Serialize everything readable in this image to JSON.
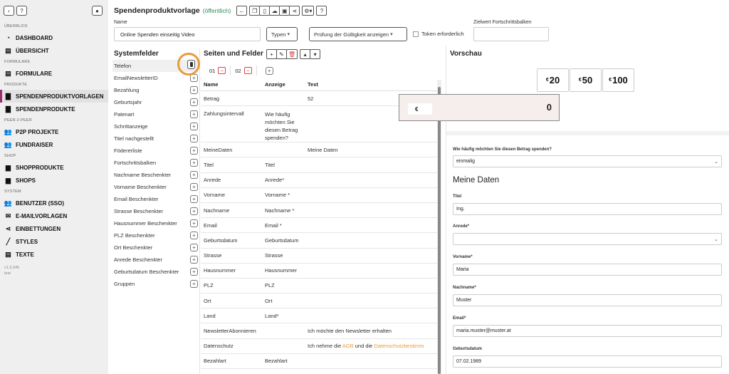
{
  "sidebar": {
    "sections": [
      {
        "title": "ÜBERBLICK",
        "items": [
          {
            "label": "DASHBOARD",
            "icon": "speedometer-icon"
          },
          {
            "label": "ÜBERSICHT",
            "icon": "document-icon"
          }
        ]
      },
      {
        "title": "FORMULARE",
        "items": [
          {
            "label": "FORMULARE",
            "icon": "document-icon"
          }
        ]
      },
      {
        "title": "PRODUKTE",
        "items": [
          {
            "label": "SPENDENPRODUKTVORLAGEN",
            "icon": "folder-icon",
            "active": true
          },
          {
            "label": "SPENDENPRODUKTE",
            "icon": "folder-icon"
          }
        ]
      },
      {
        "title": "PEER-2-PEER",
        "items": [
          {
            "label": "P2P PROJEKTE",
            "icon": "users-icon"
          },
          {
            "label": "FUNDRAISER",
            "icon": "users-icon"
          }
        ]
      },
      {
        "title": "SHOP",
        "items": [
          {
            "label": "SHOPPRODUKTE",
            "icon": "bag-icon"
          },
          {
            "label": "SHOPS",
            "icon": "bag-icon"
          }
        ]
      },
      {
        "title": "SYSTEM",
        "items": [
          {
            "label": "BENUTZER (SSO)",
            "icon": "users-icon"
          },
          {
            "label": "E-MAILVORLAGEN",
            "icon": "envelope-icon"
          },
          {
            "label": "EINBETTUNGEN",
            "icon": "share-icon"
          },
          {
            "label": "STYLES",
            "icon": "pen-icon"
          },
          {
            "label": "TEXTE",
            "icon": "document-icon"
          }
        ]
      }
    ],
    "version": "v1.3.345",
    "env": "test"
  },
  "header": {
    "title": "Spendenproduktvorlage",
    "status": "(öffentlich)"
  },
  "form": {
    "name_label": "Name",
    "name_value": "Online Spenden einseitig Video",
    "type_select": "Typen",
    "validity_select": "Prüfung der Gültigkeit anzeigen",
    "token_label": "Token erforderlich",
    "target_label": "Zielwert Fortschrittsbalken"
  },
  "system_fields": {
    "title": "Systemfelder",
    "items": [
      "Telefon",
      "EmailNewsletterID",
      "Bezahlung",
      "Geburtsjahr",
      "Patenart",
      "Schrittanzeige",
      "Titel nachgestellt",
      "Födererliste",
      "Fortschrittsbalken",
      "Nachname Beschenkter",
      "Vorname Beschenkter",
      "Email Beschenkter",
      "Strasse Beschenkter",
      "Hausnummer Beschenkter",
      "PLZ Beschenkter",
      "Ort Beschenkter",
      "Anrede Beschenkter",
      "Geburtsdatum Beschenkter",
      "Gruppen"
    ]
  },
  "pages": {
    "title": "Seiten und Felder",
    "tabs": [
      "01",
      "02"
    ],
    "columns": [
      "Name",
      "Anzeige",
      "Text"
    ],
    "rows": [
      {
        "name": "Betrag",
        "anzeige": "",
        "text": "52"
      },
      {
        "name": "Zahlungsintervall",
        "anzeige": "Wie häufig möchten Sie diesen Betrag spenden?",
        "text": ""
      },
      {
        "name": "MeineDaten",
        "anzeige": "",
        "text": "Meine Daten"
      },
      {
        "name": "Titel",
        "anzeige": "Titel",
        "text": ""
      },
      {
        "name": "Anrede",
        "anzeige": "Anrede*",
        "text": ""
      },
      {
        "name": "Vorname",
        "anzeige": "Vorname *",
        "text": ""
      },
      {
        "name": "Nachname",
        "anzeige": "Nachname *",
        "text": ""
      },
      {
        "name": "Email",
        "anzeige": "Email *",
        "text": ""
      },
      {
        "name": "Geburtsdatum",
        "anzeige": "Geburtsdatum",
        "text": ""
      },
      {
        "name": "Strasse",
        "anzeige": "Strasse",
        "text": ""
      },
      {
        "name": "Hausnummer",
        "anzeige": "Hausnummer",
        "text": ""
      },
      {
        "name": "PLZ",
        "anzeige": "PLZ",
        "text": ""
      },
      {
        "name": "Ort",
        "anzeige": "Ort",
        "text": ""
      },
      {
        "name": "Land",
        "anzeige": "Land*",
        "text": ""
      },
      {
        "name": "NewsletterAbonnieren",
        "anzeige": "",
        "text": "Ich möchte den Newsletter erhalten"
      },
      {
        "name": "Datenschutz",
        "anzeige": "",
        "text_parts": [
          "Ich nehme die ",
          "AGB",
          " und die ",
          "Datenschutzbestimm"
        ]
      },
      {
        "name": "Bezahlart",
        "anzeige": "Bezahlart",
        "text": ""
      }
    ]
  },
  "preview": {
    "title": "Vorschau",
    "currency": "€",
    "amounts": [
      "20",
      "50",
      "100"
    ],
    "amount_value": "0",
    "interval_label": "Wie häufig möchten Sie diesen Betrag spenden?",
    "interval_value": "einmalig",
    "section_title": "Meine Daten",
    "fields": [
      {
        "label": "Titel",
        "value": "Ing."
      },
      {
        "label": "Anrede*",
        "value": ""
      },
      {
        "label": "Vorname*",
        "value": "Maria"
      },
      {
        "label": "Nachname*",
        "value": "Muster"
      },
      {
        "label": "Email*",
        "value": "maria.muster@muster.at"
      },
      {
        "label": "Geburtsdatum",
        "value": "07.02.1989"
      }
    ]
  },
  "colors": {
    "accent": "#9b2f6c",
    "highlight": "#e89a3c",
    "public": "#2e8b57"
  }
}
